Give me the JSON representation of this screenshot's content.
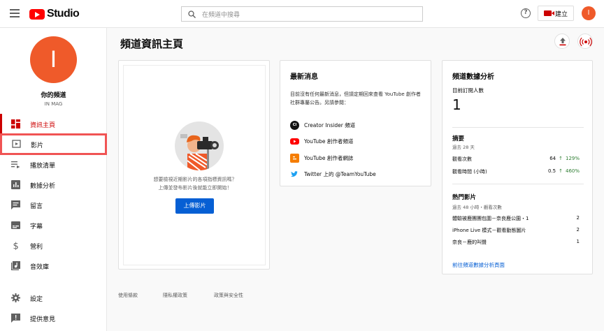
{
  "topbar": {
    "brand": "Studio",
    "search_placeholder": "在頻道中搜尋",
    "help_glyph": "?",
    "create_label": "建立",
    "avatar_letter": "I"
  },
  "channel": {
    "avatar_letter": "I",
    "name": "你的頻道",
    "handle": "IN MAG"
  },
  "sidebar": {
    "items": [
      {
        "label": "資訊主頁",
        "icon": "dashboard-icon"
      },
      {
        "label": "影片",
        "icon": "video-icon"
      },
      {
        "label": "播放清單",
        "icon": "playlist-icon"
      },
      {
        "label": "數據分析",
        "icon": "analytics-icon"
      },
      {
        "label": "留言",
        "icon": "comments-icon"
      },
      {
        "label": "字幕",
        "icon": "subtitles-icon"
      },
      {
        "label": "營利",
        "icon": "monetization-icon"
      },
      {
        "label": "音效庫",
        "icon": "audio-library-icon"
      }
    ],
    "bottom": [
      {
        "label": "設定",
        "icon": "gear-icon"
      },
      {
        "label": "提供意見",
        "icon": "feedback-icon"
      }
    ]
  },
  "main": {
    "title": "頻道資訊主頁",
    "upload_card": {
      "hint_line1": "想要檢視近期影片的各項指標資訊嗎？",
      "hint_line2": "上傳並發布影片後就能立即開始！",
      "button": "上傳影片"
    },
    "news": {
      "title": "最新消息",
      "body": "目前沒有任何最新消息，但請定期回來查看 YouTube 創作者社群專屬公告。另請參閱：",
      "links": [
        {
          "label": "Creator Insider 頻道",
          "icon": "creator-insider-icon",
          "badge": "CI"
        },
        {
          "label": "YouTube 創作者頻道",
          "icon": "youtube-icon"
        },
        {
          "label": "YouTube 創作者網誌",
          "icon": "blogger-icon"
        },
        {
          "label": "Twitter 上的 @TeamYouTube",
          "icon": "twitter-icon"
        }
      ]
    },
    "analytics": {
      "title": "頻道數據分析",
      "subscribers_label": "目前訂閱人數",
      "subscribers_value": "1",
      "summary_title": "摘要",
      "summary_period": "過去 28 天",
      "metrics": [
        {
          "label": "觀看次數",
          "value": "64",
          "change": "129%"
        },
        {
          "label": "觀看時間 (小時)",
          "value": "0.5",
          "change": "460%"
        }
      ],
      "top_title": "熱門影片",
      "top_period": "過去 48 小時・觀看次數",
      "top_videos": [
        {
          "title": "體驗被鹿團團包圍－奈良鹿公園・1",
          "views": "2"
        },
        {
          "title": "iPhone Live 模式－觀看動態圖片",
          "views": "2"
        },
        {
          "title": "奈良－鹿的叫聲",
          "views": "1"
        }
      ],
      "link": "前往頻道數據分析頁面"
    }
  },
  "footer": {
    "links": [
      "使用條款",
      "隱私權政策",
      "政策與安全性"
    ]
  },
  "colors": {
    "accent": "#cc0000",
    "avatar": "#ef5a2a",
    "link": "#065fd4",
    "positive": "#2e7d32",
    "highlight": "#f05454"
  }
}
